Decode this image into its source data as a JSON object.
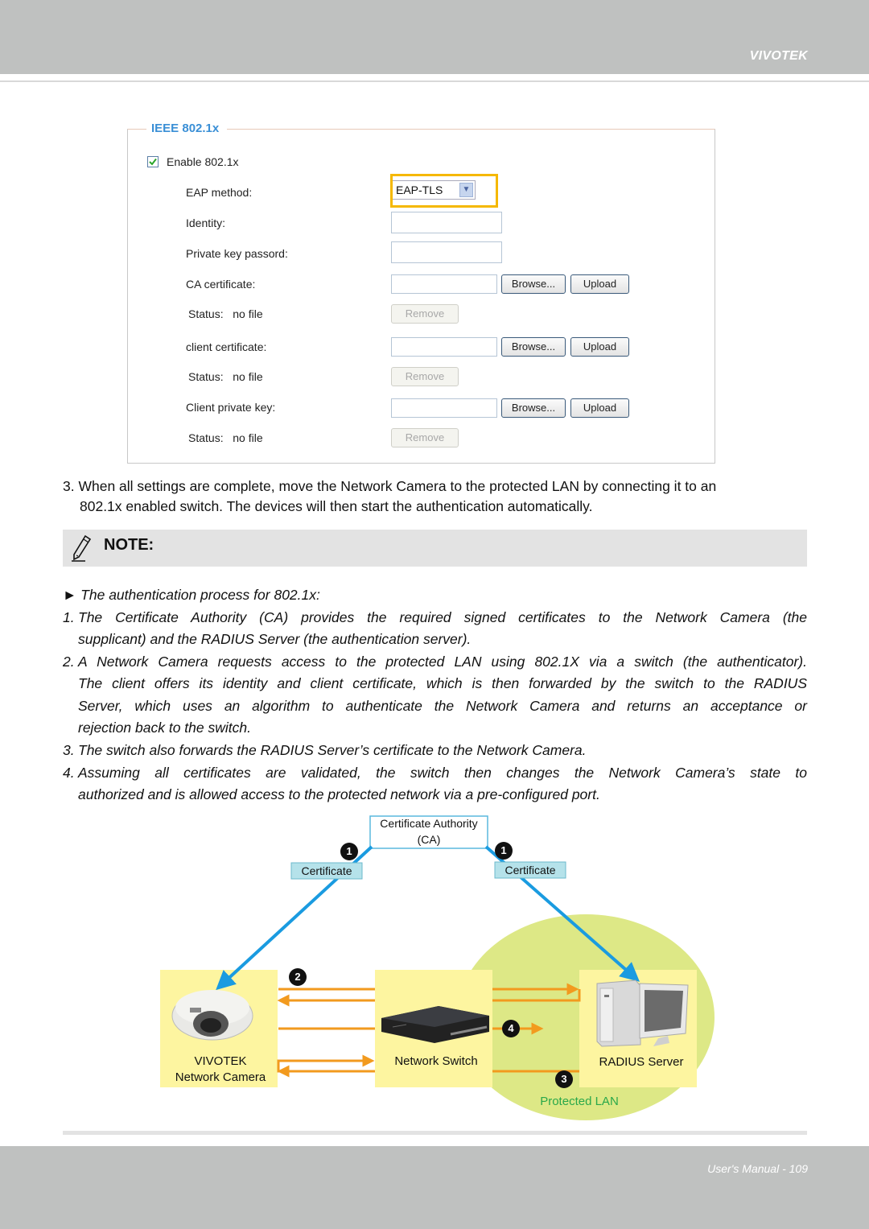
{
  "header": {
    "brand": "VIVOTEK"
  },
  "form": {
    "legend": "IEEE 802.1x",
    "enable_label": "Enable 802.1x",
    "enable_checked": true,
    "eap_method_label": "EAP method:",
    "eap_method_value": "EAP-TLS",
    "identity_label": "Identity:",
    "identity_value": "",
    "private_key_password_label": "Private key passord:",
    "private_key_password_value": "",
    "ca_certificate_label": "CA certificate:",
    "client_certificate_label": "client certificate:",
    "client_private_key_label": "Client private key:",
    "status_label": "Status:",
    "status_value": "no file",
    "browse_label": "Browse...",
    "upload_label": "Upload",
    "remove_label": "Remove"
  },
  "step3": {
    "line1": "3. When all settings are complete, move the Network Camera to the protected LAN by connecting it to an",
    "line2": "802.1x enabled switch. The devices will then start the authentication automatically."
  },
  "note": {
    "title": "NOTE:",
    "intro": "► The authentication process for 802.1x:",
    "items": [
      {
        "num": "1.",
        "lines": [
          "The Certificate Authority (CA) provides the required signed certificates to the Network Camera (the",
          "supplicant) and the RADIUS Server (the authentication server)."
        ]
      },
      {
        "num": "2.",
        "lines": [
          "A Network Camera requests access to the protected LAN using 802.1X via a switch (the authenticator).",
          "The client offers its identity and client certificate, which is then forwarded by the switch to the RADIUS",
          "Server, which uses an algorithm to authenticate the Network Camera and returns an acceptance or",
          "rejection back to the switch."
        ]
      },
      {
        "num": "3.",
        "lines": [
          "The switch also forwards the RADIUS Server’s certificate to the Network Camera."
        ]
      },
      {
        "num": "4.",
        "lines": [
          "Assuming all certificates are validated, the switch then changes the Network Camera’s state to",
          "authorized and is allowed access to the protected network via a pre-configured port."
        ]
      }
    ]
  },
  "diagram": {
    "ca_line1": "Certificate Authority",
    "ca_line2": "(CA)",
    "certificate_label": "Certificate",
    "camera_line1": "VIVOTEK",
    "camera_line2": "Network Camera",
    "switch_label": "Network Switch",
    "radius_label": "RADIUS Server",
    "protected_lan_label": "Protected LAN",
    "step_badges": [
      "1",
      "1",
      "2",
      "3",
      "4"
    ],
    "colors": {
      "cert_arrow": "#1a9be0",
      "flow_arrow": "#f29a1e",
      "device_box": "#fdf5a0",
      "lan_area": "#dde886",
      "cert_tag": "#b5e2ea",
      "lan_text": "#2aa84a"
    }
  },
  "footer": {
    "page_label": "User's Manual - 109"
  }
}
